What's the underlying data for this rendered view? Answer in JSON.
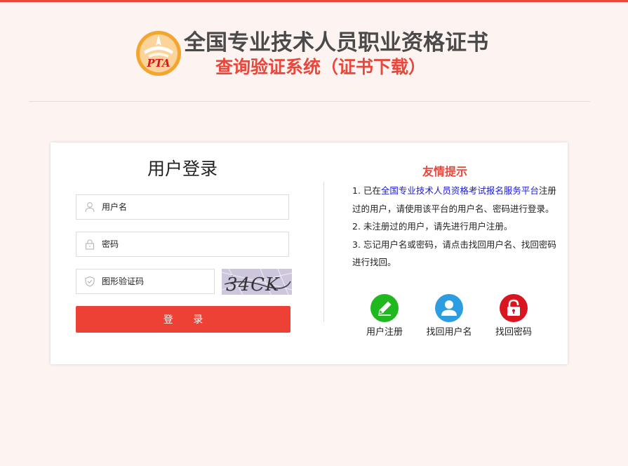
{
  "header": {
    "logo_text": "PTA",
    "title_main": "全国专业技术人员职业资格证书",
    "title_sub": "查询验证系统（证书下载）"
  },
  "login": {
    "title": "用户登录",
    "username_placeholder": "用户名",
    "password_placeholder": "密码",
    "captcha_placeholder": "图形验证码",
    "captcha_text": "34CK",
    "submit_label": "登 录"
  },
  "tips": {
    "title": "友情提示",
    "line1_prefix": "1. 已在",
    "line1_link": "全国专业技术人员资格考试报名服务平台",
    "line1_suffix": "注册过的用户，请使用该平台的用户名、密码进行登录。",
    "line2": "2. 未注册过的用户，请先进行用户注册。",
    "line3": "3. 忘记用户名或密码，请点击找回用户名、找回密码进行找回。"
  },
  "actions": [
    {
      "label": "用户注册",
      "icon": "pencil-icon",
      "color": "#1fb81f"
    },
    {
      "label": "找回用户名",
      "icon": "user-icon",
      "color": "#2b9de0"
    },
    {
      "label": "找回密码",
      "icon": "lock-icon",
      "color": "#d9161f"
    }
  ],
  "colors": {
    "accent": "#e8473b",
    "button": "#ee4136",
    "link": "#1a1ad6",
    "background": "#fdf4f1"
  }
}
